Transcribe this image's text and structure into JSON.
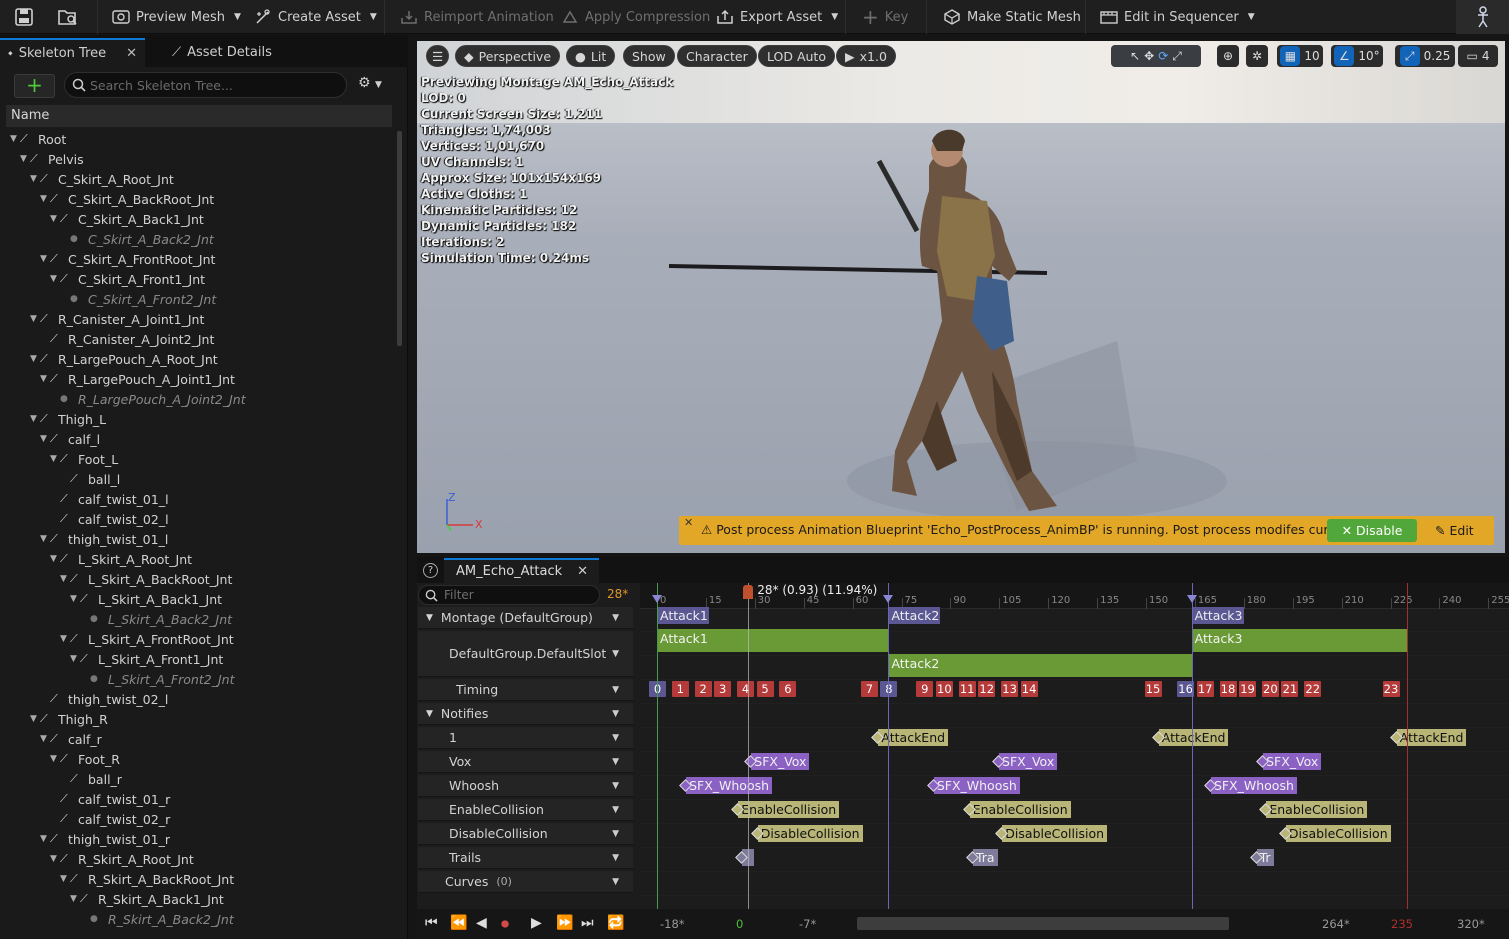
{
  "toolbar": {
    "preview_mesh": "Preview Mesh",
    "create_asset": "Create Asset",
    "reimport_animation": "Reimport Animation",
    "apply_compression": "Apply Compression",
    "export_asset": "Export Asset",
    "key": "Key",
    "make_static_mesh": "Make Static Mesh",
    "edit_in_sequencer": "Edit in Sequencer"
  },
  "left_panel": {
    "tab_skeleton_tree": "Skeleton Tree",
    "tab_asset_details": "Asset Details",
    "search_placeholder": "Search Skeleton Tree...",
    "name_header": "Name",
    "bones": [
      {
        "label": "Root",
        "depth": 0,
        "expanded": true,
        "dim": false
      },
      {
        "label": "Pelvis",
        "depth": 1,
        "expanded": true,
        "dim": false
      },
      {
        "label": "C_Skirt_A_Root_Jnt",
        "depth": 2,
        "expanded": true,
        "dim": false
      },
      {
        "label": "C_Skirt_A_BackRoot_Jnt",
        "depth": 3,
        "expanded": true,
        "dim": false
      },
      {
        "label": "C_Skirt_A_Back1_Jnt",
        "depth": 4,
        "expanded": true,
        "dim": false
      },
      {
        "label": "C_Skirt_A_Back2_Jnt",
        "depth": 5,
        "expanded": false,
        "dim": true
      },
      {
        "label": "C_Skirt_A_FrontRoot_Jnt",
        "depth": 3,
        "expanded": true,
        "dim": false
      },
      {
        "label": "C_Skirt_A_Front1_Jnt",
        "depth": 4,
        "expanded": true,
        "dim": false
      },
      {
        "label": "C_Skirt_A_Front2_Jnt",
        "depth": 5,
        "expanded": false,
        "dim": true
      },
      {
        "label": "R_Canister_A_Joint1_Jnt",
        "depth": 2,
        "expanded": true,
        "dim": false
      },
      {
        "label": "R_Canister_A_Joint2_Jnt",
        "depth": 3,
        "expanded": false,
        "dim": false
      },
      {
        "label": "R_LargePouch_A_Root_Jnt",
        "depth": 2,
        "expanded": true,
        "dim": false
      },
      {
        "label": "R_LargePouch_A_Joint1_Jnt",
        "depth": 3,
        "expanded": true,
        "dim": false
      },
      {
        "label": "R_LargePouch_A_Joint2_Jnt",
        "depth": 4,
        "expanded": false,
        "dim": true
      },
      {
        "label": "Thigh_L",
        "depth": 2,
        "expanded": true,
        "dim": false
      },
      {
        "label": "calf_l",
        "depth": 3,
        "expanded": true,
        "dim": false
      },
      {
        "label": "Foot_L",
        "depth": 4,
        "expanded": true,
        "dim": false
      },
      {
        "label": "ball_l",
        "depth": 5,
        "expanded": false,
        "dim": false
      },
      {
        "label": "calf_twist_01_l",
        "depth": 4,
        "expanded": false,
        "dim": false
      },
      {
        "label": "calf_twist_02_l",
        "depth": 4,
        "expanded": false,
        "dim": false
      },
      {
        "label": "thigh_twist_01_l",
        "depth": 3,
        "expanded": true,
        "dim": false
      },
      {
        "label": "L_Skirt_A_Root_Jnt",
        "depth": 4,
        "expanded": true,
        "dim": false
      },
      {
        "label": "L_Skirt_A_BackRoot_Jnt",
        "depth": 5,
        "expanded": true,
        "dim": false
      },
      {
        "label": "L_Skirt_A_Back1_Jnt",
        "depth": 6,
        "expanded": true,
        "dim": false
      },
      {
        "label": "L_Skirt_A_Back2_Jnt",
        "depth": 7,
        "expanded": false,
        "dim": true
      },
      {
        "label": "L_Skirt_A_FrontRoot_Jnt",
        "depth": 5,
        "expanded": true,
        "dim": false
      },
      {
        "label": "L_Skirt_A_Front1_Jnt",
        "depth": 6,
        "expanded": true,
        "dim": false
      },
      {
        "label": "L_Skirt_A_Front2_Jnt",
        "depth": 7,
        "expanded": false,
        "dim": true
      },
      {
        "label": "thigh_twist_02_l",
        "depth": 3,
        "expanded": false,
        "dim": false
      },
      {
        "label": "Thigh_R",
        "depth": 2,
        "expanded": true,
        "dim": false
      },
      {
        "label": "calf_r",
        "depth": 3,
        "expanded": true,
        "dim": false
      },
      {
        "label": "Foot_R",
        "depth": 4,
        "expanded": true,
        "dim": false
      },
      {
        "label": "ball_r",
        "depth": 5,
        "expanded": false,
        "dim": false
      },
      {
        "label": "calf_twist_01_r",
        "depth": 4,
        "expanded": false,
        "dim": false
      },
      {
        "label": "calf_twist_02_r",
        "depth": 4,
        "expanded": false,
        "dim": false
      },
      {
        "label": "thigh_twist_01_r",
        "depth": 3,
        "expanded": true,
        "dim": false
      },
      {
        "label": "R_Skirt_A_Root_Jnt",
        "depth": 4,
        "expanded": true,
        "dim": false
      },
      {
        "label": "R_Skirt_A_BackRoot_Jnt",
        "depth": 5,
        "expanded": true,
        "dim": false
      },
      {
        "label": "R_Skirt_A_Back1_Jnt",
        "depth": 6,
        "expanded": true,
        "dim": false
      },
      {
        "label": "R_Skirt_A_Back2_Jnt",
        "depth": 7,
        "expanded": false,
        "dim": true
      }
    ]
  },
  "viewport": {
    "perspective": "Perspective",
    "lit": "Lit",
    "show": "Show",
    "character": "Character",
    "lod": "LOD Auto",
    "play_rate": "x1.0",
    "grid_snap": "10",
    "rot_snap": "10°",
    "scale_snap": "0.25",
    "camera_speed": "4",
    "stats": [
      "Previewing Montage AM_Echo_Attack",
      "LOD: 0",
      "Current Screen Size: 1.211",
      "Triangles: 1,74,003",
      "Vertices: 1,01,670",
      "UV Channels: 1",
      "Approx Size: 101x154x169",
      "Active Cloths: 1",
      "Kinematic Particles: 12",
      "Dynamic Particles: 182",
      "Iterations: 2",
      "Simulation Time: 0.24ms"
    ],
    "warning": "Post process Animation Blueprint 'Echo_PostProcess_AnimBP' is running. Post process modifes curves.",
    "disable_label": "Disable",
    "edit_label": "Edit",
    "colors": {
      "warning_bg": "#e3a728",
      "disable_bg": "#52a73a",
      "accent": "#1264b8"
    }
  },
  "montage": {
    "tab": "AM_Echo_Attack",
    "filter_placeholder": "Filter",
    "frame_count": "28*",
    "playhead_label": "28* (0.93) (11.94%)",
    "tracks": {
      "montage": "Montage (DefaultGroup)",
      "slot": "DefaultGroup.DefaultSlot",
      "timing": "Timing",
      "notifies": "Notifies",
      "n1": "1",
      "vox": "Vox",
      "whoosh": "Whoosh",
      "enable": "EnableCollision",
      "disable": "DisableCollision",
      "trails": "Trails",
      "curves": "Curves",
      "curves_count": "(0)"
    },
    "ruler_ticks": [
      "0",
      "15",
      "30",
      "45",
      "60",
      "75",
      "90",
      "105",
      "120",
      "135",
      "150",
      "165",
      "180",
      "195",
      "210",
      "225",
      "240",
      "255"
    ],
    "sections": [
      {
        "label": "Attack1",
        "start": 0,
        "end": 71
      },
      {
        "label": "Attack2",
        "start": 71,
        "end": 164
      },
      {
        "label": "Attack3",
        "start": 164,
        "end": 230
      }
    ],
    "timing_markers": [
      {
        "n": "0",
        "f": 0,
        "blue": true
      },
      {
        "n": "1",
        "f": 7
      },
      {
        "n": "2",
        "f": 14
      },
      {
        "n": "3",
        "f": 20
      },
      {
        "n": "4",
        "f": 27
      },
      {
        "n": "5",
        "f": 33
      },
      {
        "n": "6",
        "f": 40
      },
      {
        "n": "7",
        "f": 65
      },
      {
        "n": "8",
        "f": 71,
        "blue": true
      },
      {
        "n": "9",
        "f": 82
      },
      {
        "n": "10",
        "f": 88
      },
      {
        "n": "11",
        "f": 95
      },
      {
        "n": "12",
        "f": 101
      },
      {
        "n": "13",
        "f": 108
      },
      {
        "n": "14",
        "f": 114
      },
      {
        "n": "15",
        "f": 152
      },
      {
        "n": "16",
        "f": 162,
        "blue": true
      },
      {
        "n": "17",
        "f": 168
      },
      {
        "n": "18",
        "f": 175
      },
      {
        "n": "19",
        "f": 181
      },
      {
        "n": "20",
        "f": 188
      },
      {
        "n": "21",
        "f": 194
      },
      {
        "n": "22",
        "f": 201
      },
      {
        "n": "23",
        "f": 225
      }
    ],
    "notifies": {
      "n1": [
        {
          "label": "AttackEnd",
          "f": 67
        },
        {
          "label": "AttackEnd",
          "f": 153
        },
        {
          "label": "AttackEnd",
          "f": 226
        }
      ],
      "vox": [
        {
          "label": "SFX_Vox",
          "f": 28
        },
        {
          "label": "SFX_Vox",
          "f": 104
        },
        {
          "label": "SFX_Vox",
          "f": 185
        }
      ],
      "whoosh": [
        {
          "label": "SFX_Whoosh",
          "f": 8
        },
        {
          "label": "SFX_Whoosh",
          "f": 84
        },
        {
          "label": "SFX_Whoosh",
          "f": 169
        }
      ],
      "enable": [
        {
          "label": "EnableCollision",
          "f": 24
        },
        {
          "label": "EnableCollision",
          "f": 95
        },
        {
          "label": "EnableCollision",
          "f": 186
        }
      ],
      "disable": [
        {
          "label": "DisableCollision",
          "f": 30
        },
        {
          "label": "DisableCollision",
          "f": 105
        },
        {
          "label": "DisableCollision",
          "f": 192
        }
      ],
      "trails": [
        {
          "label": "",
          "f": 25
        },
        {
          "label": "Tra",
          "f": 96
        },
        {
          "label": "Tr",
          "f": 183
        }
      ]
    },
    "transport": {
      "range_start": "-18*",
      "start": "0",
      "view_start": "-7*",
      "view_end": "264*",
      "end": "235",
      "range_end": "320*"
    }
  }
}
